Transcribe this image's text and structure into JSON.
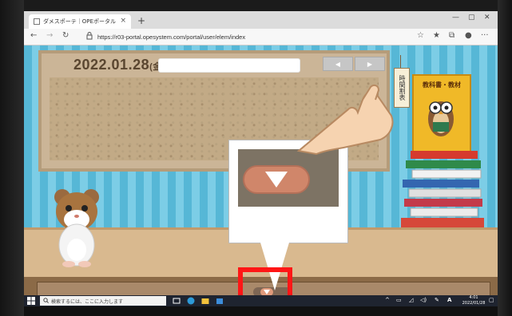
{
  "browser": {
    "tab_title": "ダメスポーテ｜OPEポータル",
    "tab_close": "×",
    "new_tab": "+",
    "url": "https://r03-portal.opesystem.com/portal/user/elem/index"
  },
  "page": {
    "date": "2022.01.28",
    "day": "(金)",
    "timetable_label": "時間割表",
    "textbook_label": "教科書・教材"
  },
  "taskbar": {
    "search_placeholder": "検索するには、ここに入力します",
    "ime_label": "A",
    "time": "4:01",
    "date": "2022/01/28"
  },
  "colors": {
    "highlight": "#ff1616",
    "arrow_button": "#d0866a",
    "stripe_a": "#56b7d6",
    "stripe_b": "#7ccde6"
  }
}
